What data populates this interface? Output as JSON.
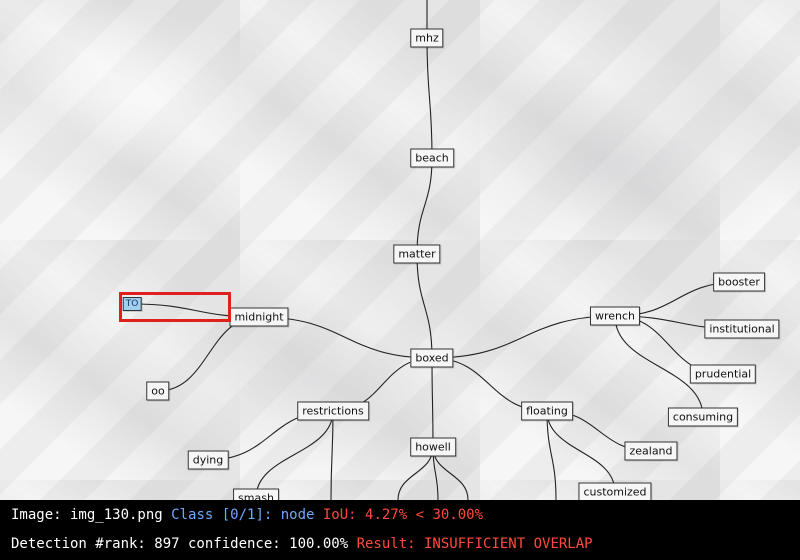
{
  "colors": {
    "detection_box": "#e0201c",
    "highlight_node_fill": "#9fd0f0",
    "hud_background": "#000000",
    "hud_text": "#ffffff",
    "hud_class": "#6fa8ff",
    "hud_fail": "#ff4a3d"
  },
  "diagram": {
    "nodes": [
      {
        "id": "mhz",
        "label": "mhz"
      },
      {
        "id": "beach",
        "label": "beach"
      },
      {
        "id": "matter",
        "label": "matter"
      },
      {
        "id": "to",
        "label": "TO"
      },
      {
        "id": "midnight",
        "label": "midnight"
      },
      {
        "id": "oo",
        "label": "oo"
      },
      {
        "id": "boxed",
        "label": "boxed"
      },
      {
        "id": "wrench",
        "label": "wrench"
      },
      {
        "id": "booster",
        "label": "booster"
      },
      {
        "id": "institutional",
        "label": "institutional"
      },
      {
        "id": "prudential",
        "label": "prudential"
      },
      {
        "id": "consuming",
        "label": "consuming"
      },
      {
        "id": "restrictions",
        "label": "restrictions"
      },
      {
        "id": "floating",
        "label": "floating"
      },
      {
        "id": "zealand",
        "label": "zealand"
      },
      {
        "id": "customized",
        "label": "customized"
      },
      {
        "id": "howell",
        "label": "howell"
      },
      {
        "id": "dying",
        "label": "dying"
      },
      {
        "id": "smash",
        "label": "smash"
      }
    ]
  },
  "hud": {
    "line1": [
      {
        "text": "Image: img_130.png ",
        "color": "white"
      },
      {
        "text": "Class [0/1]: node ",
        "color": "blue"
      },
      {
        "text": "IoU: 4.27% < 30.00%",
        "color": "red"
      }
    ],
    "line2": [
      {
        "text": "Detection #rank: 897 confidence: 100.00% ",
        "color": "white"
      },
      {
        "text": "Result: INSUFFICIENT OVERLAP",
        "color": "red"
      }
    ]
  }
}
